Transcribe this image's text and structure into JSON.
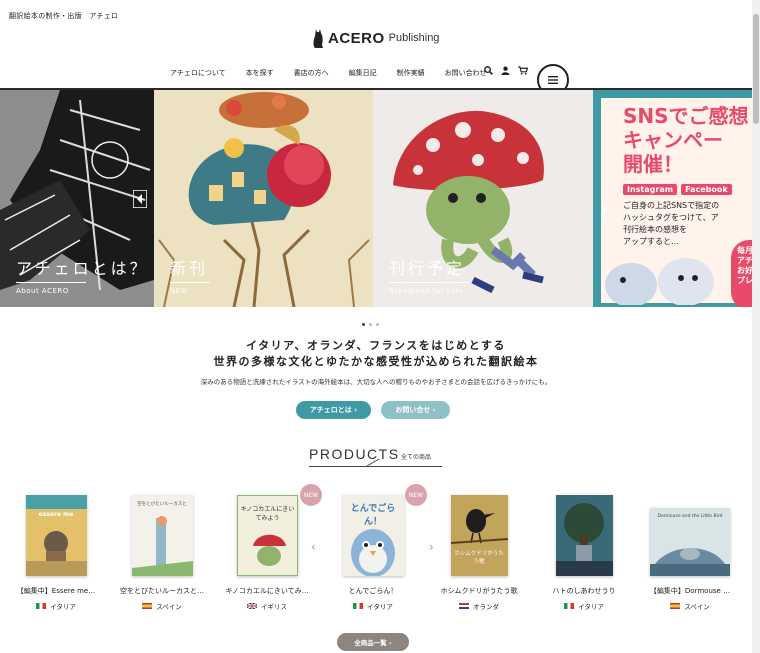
{
  "header": {
    "tagline": "翻訳絵本の制作・出版　アチェロ",
    "logo_text": "ACERO",
    "logo_sub": "Publishing",
    "nav": [
      "アチェロについて",
      "本を探す",
      "書店の方へ",
      "編集日記",
      "制作実績",
      "お問い合わせ"
    ],
    "icons": [
      "search-icon",
      "user-icon",
      "cart-icon",
      "menu-icon"
    ]
  },
  "hero": {
    "slides": [
      {
        "caption": "アチェロとは？",
        "sub": "About ACERO"
      },
      {
        "caption": "新刊",
        "sub": "NEW"
      },
      {
        "caption": "刊行予定",
        "sub": "Scheduled for sale"
      },
      {
        "title_lines": [
          "SNSでご感想",
          "キャンペー",
          "開催！"
        ],
        "tags": [
          "Instagram",
          "Facebook"
        ],
        "body": [
          "ご自身の上記SNSで指定の",
          "ハッシュタグをつけて、ア",
          "刊行絵本の感想を",
          "アップすると…"
        ],
        "badge": [
          "毎月",
          "アチ",
          "お好",
          "プレ"
        ]
      }
    ],
    "dots": 3,
    "active_dot": 0
  },
  "intro": {
    "line1": "イタリア、オランダ、フランスをはじめとする",
    "line2": "世界の多様な文化とゆたかな感受性が込められた翻訳絵本",
    "sub": "深みのある物語と洗練されたイラストの海外絵本は、大切な人への贈りものやお子さまとの会話を広げるきっかけにも。",
    "btn_about": "アチェロとは ›",
    "btn_contact": "お問い合せ ›"
  },
  "products": {
    "title": "PRODUCTS",
    "title_sub": "全ての商品",
    "new_label": "NEW",
    "items": [
      {
        "title": "【編集中】Essere me…",
        "country": "イタリア",
        "flag": "it"
      },
      {
        "title": "空をとびたいルーカスと…",
        "country": "スペイン",
        "flag": "es"
      },
      {
        "title": "キノコカエルにきいてみ…",
        "country": "イギリス",
        "flag": "uk"
      },
      {
        "title": "とんでごらん！",
        "country": "イタリア",
        "flag": "it"
      },
      {
        "title": "ホシムクドリがうたう歌",
        "country": "オランダ",
        "flag": "nl"
      },
      {
        "title": "ハトのしあわせうり",
        "country": "イタリア",
        "flag": "it"
      },
      {
        "title": "【編集中】Dormouse …",
        "country": "スペイン",
        "flag": "es"
      }
    ],
    "covers": [
      {
        "title": "essere me"
      },
      {
        "title": "空をとびたいルーカスと"
      },
      {
        "title": "キノコカエルにきいてみよう"
      },
      {
        "title": "とんでごらん！"
      },
      {
        "title": "ホシムクドリがうたう歌"
      },
      {
        "title": ""
      },
      {
        "title": "Dormouse and the Little Bird"
      }
    ],
    "all_button": "全商品一覧 ›"
  },
  "colors": {
    "teal": "#3f9aa4",
    "teal_light": "#8ec0c7",
    "pink": "#d9a3ad",
    "gray_btn": "#8c8580"
  }
}
